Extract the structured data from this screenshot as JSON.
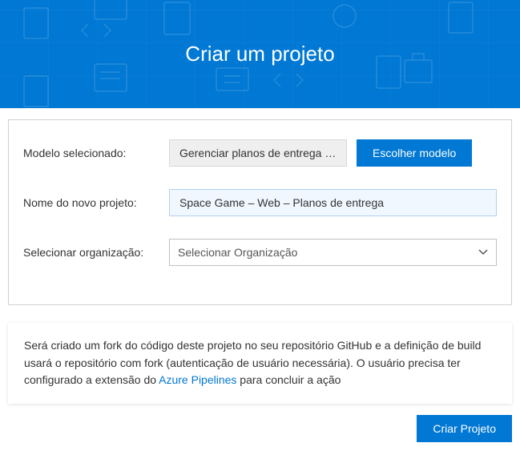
{
  "banner": {
    "title": "Criar um projeto"
  },
  "form": {
    "model_label": "Modelo selecionado:",
    "model_value": "Gerenciar planos de entrega de...",
    "choose_model_button": "Escolher modelo",
    "project_name_label": "Nome do novo projeto:",
    "project_name_value": "Space Game – Web – Planos de entrega",
    "org_label": "Selecionar organização:",
    "org_placeholder": "Selecionar Organização"
  },
  "info": {
    "text_before_link": "Será criado um fork do código deste projeto no seu repositório GitHub e a definição de build usará o repositório com fork (autenticação de usuário necessária). O usuário precisa ter configurado a extensão do ",
    "link_text": "Azure Pipelines",
    "text_after_link": " para concluir a ação"
  },
  "actions": {
    "create_button": "Criar Projeto"
  }
}
